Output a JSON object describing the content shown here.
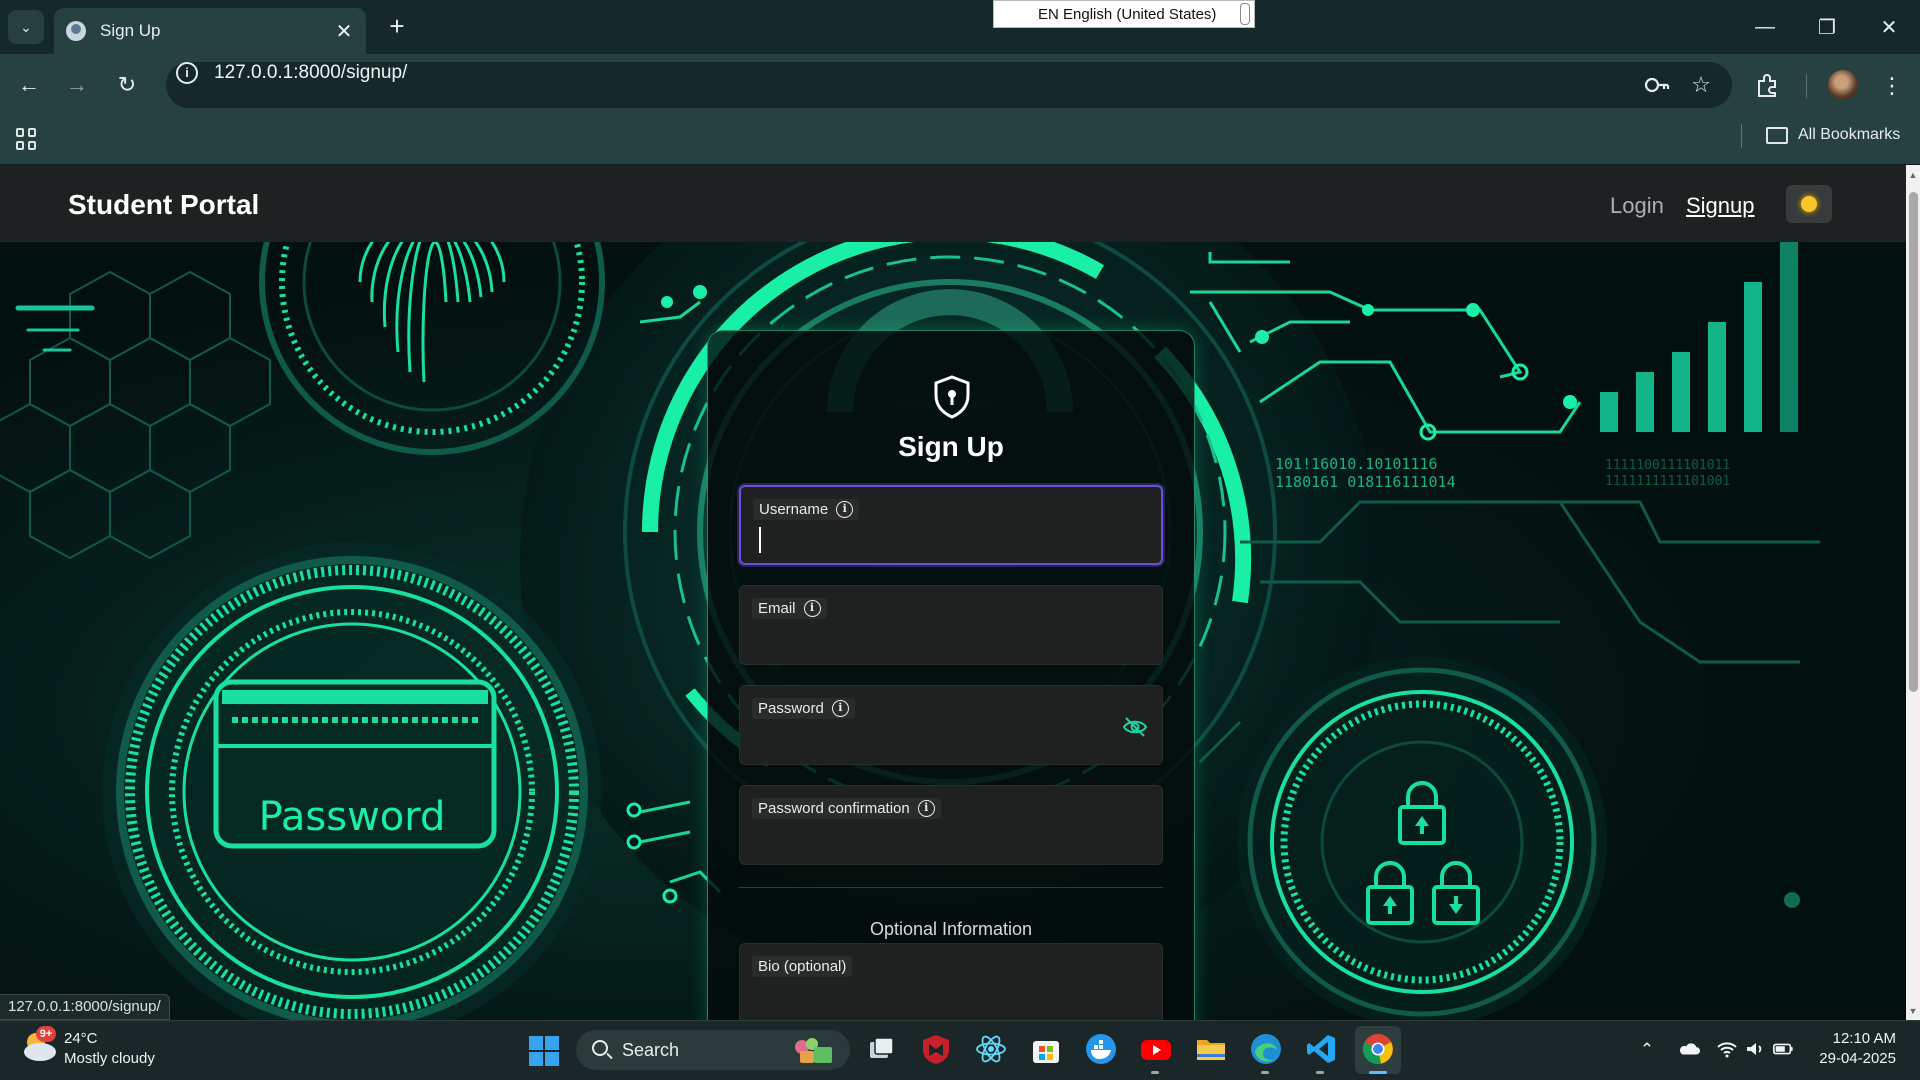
{
  "browser": {
    "tab_title": "Sign Up",
    "url": "127.0.0.1:8000/signup/",
    "bookmarks_label": "All Bookmarks",
    "language_popup": "EN English (United States)",
    "status_url": "127.0.0.1:8000/signup/"
  },
  "nav": {
    "brand": "Student Portal",
    "login": "Login",
    "signup": "Signup"
  },
  "hero": {
    "password_card_text": "Password",
    "binary_line_1": "101!16010.10101116",
    "binary_line_2": "1180161 018116111014",
    "binary_right_1": "1111100111101011",
    "binary_right_2": "1111111111101001"
  },
  "form": {
    "title": "Sign Up",
    "fields": [
      {
        "label": "Username",
        "value": ""
      },
      {
        "label": "Email",
        "value": ""
      },
      {
        "label": "Password",
        "value": ""
      },
      {
        "label": "Password confirmation",
        "value": ""
      }
    ],
    "optional_section": "Optional Information",
    "bio_label": "Bio (optional)"
  },
  "taskbar": {
    "weather_badge": "9+",
    "temperature": "24°C",
    "weather": "Mostly cloudy",
    "search_label": "Search",
    "time": "12:10 AM",
    "date": "29-04-2025"
  },
  "colors": {
    "accent_green": "#19f0a6",
    "focus_purple": "#6b4fd8",
    "nav_bg": "#1e2121",
    "chrome_bg": "#274140"
  },
  "icons": [
    "back-icon",
    "forward-icon",
    "reload-icon",
    "site-info-icon",
    "password-key-icon",
    "star-icon",
    "extensions-icon",
    "menu-icon",
    "apps-grid-icon",
    "folder-icon",
    "shield-keyhole-icon",
    "info-icon",
    "eye-off-icon",
    "sun-icon",
    "windows-start-icon",
    "search-icon"
  ]
}
